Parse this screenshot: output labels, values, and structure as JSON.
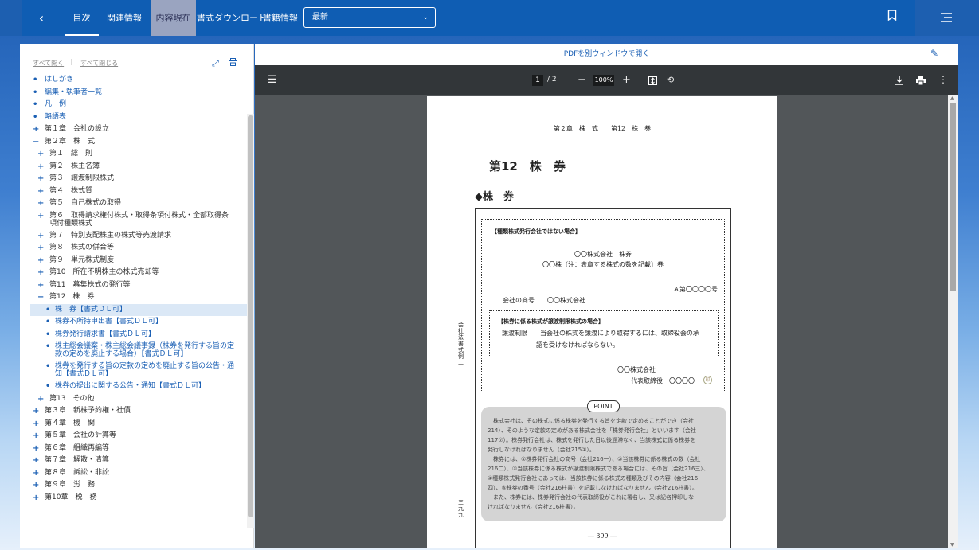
{
  "topbar": {
    "back_label": "‹",
    "tabs": [
      "目次",
      "関連情報",
      "内容現在",
      "書式ダウンロード",
      "書籍情報"
    ],
    "select_value": "最新",
    "bookmark_icon": "bookmark-icon",
    "menu_icon": "hamburger-icon"
  },
  "left": {
    "expand_all": "すべて開く",
    "collapse_all": "すべて閉じる",
    "tree": [
      {
        "mk": "•",
        "tx": "はしがき",
        "blue": true
      },
      {
        "mk": "•",
        "tx": "編集・執筆者一覧",
        "blue": true
      },
      {
        "mk": "•",
        "tx": "凡　例",
        "blue": true
      },
      {
        "mk": "•",
        "tx": "略語表",
        "blue": true
      },
      {
        "mk": "+",
        "tx": "第１章　会社の設立"
      },
      {
        "mk": "−",
        "tx": "第２章　株　式"
      },
      {
        "mk": "+",
        "tx": "第１　総　則"
      },
      {
        "mk": "+",
        "tx": "第２　株主名簿"
      },
      {
        "mk": "+",
        "tx": "第３　譲渡制限株式"
      },
      {
        "mk": "+",
        "tx": "第４　株式質"
      },
      {
        "mk": "+",
        "tx": "第５　自己株式の取得"
      },
      {
        "mk": "+",
        "tx": "第６　取得請求権付株式・取得条項付株式・全部取得条",
        "tx2": "項付種類株式"
      },
      {
        "mk": "+",
        "tx": "第７　特別支配株主の株式等売渡請求"
      },
      {
        "mk": "+",
        "tx": "第８　株式の併合等"
      },
      {
        "mk": "+",
        "tx": "第９　単元株式制度"
      },
      {
        "mk": "+",
        "tx": "第10　所在不明株主の株式売却等"
      },
      {
        "mk": "+",
        "tx": "第11　募集株式の発行等"
      },
      {
        "mk": "−",
        "tx": "第12　株　券"
      },
      {
        "mk": "•",
        "tx": "株　券【書式ＤＬ可】",
        "blue": true,
        "selected": true
      },
      {
        "mk": "•",
        "tx": "株券不所持申出書【書式ＤＬ可】",
        "blue": true
      },
      {
        "mk": "•",
        "tx": "株券発行請求書【書式ＤＬ可】",
        "blue": true
      },
      {
        "mk": "•",
        "tx": "株主総会議案・株主総会議事録（株券を発行する旨の定",
        "tx2": "款の定めを廃止する場合）【書式ＤＬ可】",
        "blue": true
      },
      {
        "mk": "•",
        "tx": "株券を発行する旨の定款の定めを廃止する旨の公告・通",
        "tx2": "知【書式ＤＬ可】",
        "blue": true
      },
      {
        "mk": "•",
        "tx": "株券の提出に関する公告・通知【書式ＤＬ可】",
        "blue": true
      },
      {
        "mk": "+",
        "tx": "第13　その他"
      },
      {
        "mk": "+",
        "tx": "第３章　新株予約権・社債"
      },
      {
        "mk": "+",
        "tx": "第４章　機　関"
      },
      {
        "mk": "+",
        "tx": "第５章　会社の計算等"
      },
      {
        "mk": "+",
        "tx": "第６章　組織再編等"
      },
      {
        "mk": "+",
        "tx": "第７章　解散・清算"
      },
      {
        "mk": "+",
        "tx": "第８章　訴訟・非訟"
      },
      {
        "mk": "+",
        "tx": "第９章　労　務"
      },
      {
        "mk": "+",
        "tx": "第10章　税　務"
      }
    ]
  },
  "right": {
    "pdf_link": "PDFを別ウィンドウで開く",
    "viewer": {
      "page_current": "1",
      "page_total": "/ 2",
      "zoom": "100%"
    },
    "page": {
      "running_head": "第２章　株　式　　第12　株　券",
      "title": "第12　株　券",
      "subtitle": "◆株　券",
      "form_heading": "【種類株式発行会社ではない場合】",
      "company_cert": "〇〇株式会社　株券",
      "cert_line2": "〇〇株〔注：表章する株式の数を記載〕券",
      "cert_no": "Ａ第〇〇〇〇号",
      "trade_name": "会社の商号　　〇〇株式会社",
      "restrict_heading": "【株券に係る株式が譲渡制限株式の場合】",
      "restrict_l1": "譲渡制限　　当会社の株式を譲渡により取得するには、取締役会の承",
      "restrict_l2": "認を受けなければならない。",
      "company_sign": "〇〇株式会社",
      "rep_sign": "代表取締役　〇〇〇〇",
      "seal": "印",
      "point": "POINT",
      "point_text": [
        "　株式会社は、その株式に係る株券を発行する旨を定款で定めることができ（会社",
        "214）、そのような定款の定めがある株式会社を「株券発行会社」といいます（会社",
        "117⑦）。株券発行会社は、株式を発行した日以後遅滞なく、当該株式に係る株券を",
        "発行しなければなりません（会社215①）。",
        "　株券には、①株券発行会社の商号（会社216一）、②当該株券に係る株式の数（会社",
        "216二）、③当該株券に係る株式が譲渡制限株式である場合には、その旨（会社216三）、",
        "④種類株式発行会社にあっては、当該株券に係る株式の種類及びその内容（会社216",
        "四）、⑤株券の番号（会社216柱書）を記載しなければなりません（会社216柱書）。",
        "　また、株券には、株券発行会社の代表取締役がこれに署名し、又は記名押印しな",
        "ければなりません（会社216柱書）。"
      ],
      "side_label": "会社法書式例二",
      "side_num": "三九九",
      "page_number": "― 399 ―"
    }
  }
}
